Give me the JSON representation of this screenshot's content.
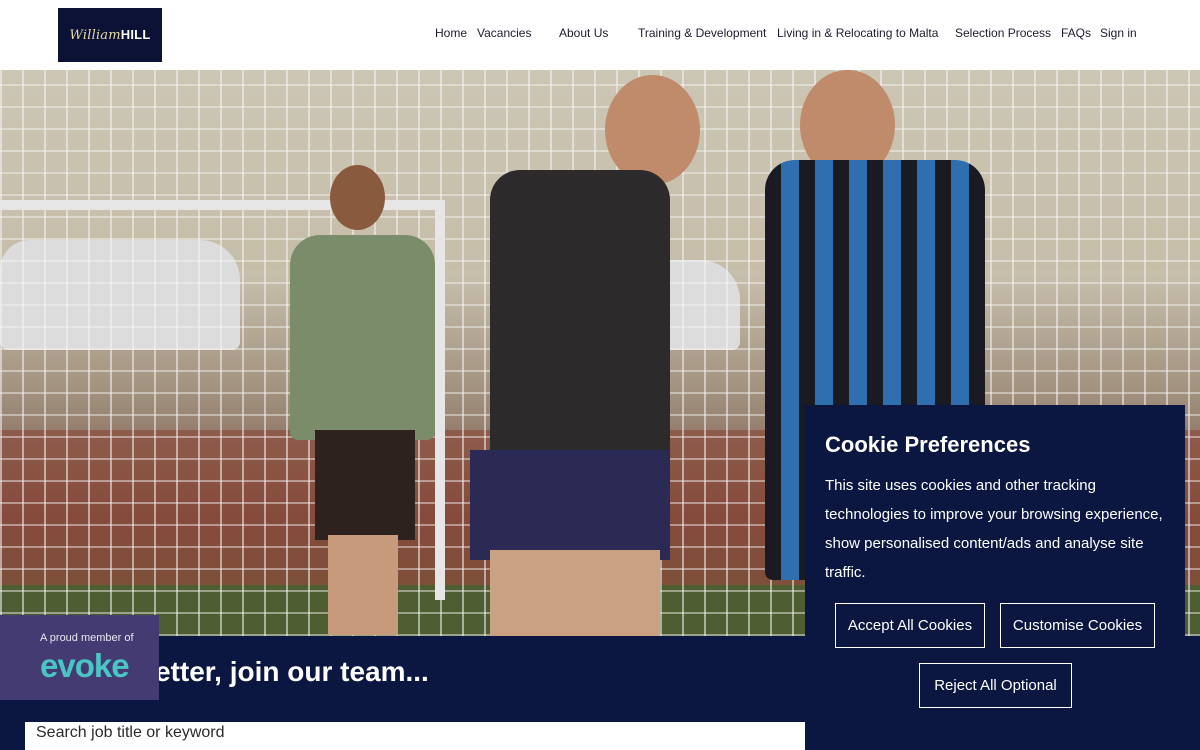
{
  "brand": {
    "logo_script": "William",
    "logo_bold": "HILL"
  },
  "nav": {
    "items": [
      {
        "label": "Home"
      },
      {
        "label": "Vacancies"
      },
      {
        "label": "About Us"
      },
      {
        "label": "Training & Development"
      },
      {
        "label": "Living in & Relocating to Malta"
      },
      {
        "label": "Selection Process"
      },
      {
        "label": "FAQs"
      },
      {
        "label": "Sign in"
      }
    ]
  },
  "hero": {
    "image_description": ""
  },
  "band": {
    "title": "etter, join our team..."
  },
  "search": {
    "placeholder": "Search job title or keyword",
    "button_icon": "search-icon"
  },
  "evoke": {
    "tagline": "A proud member of",
    "logo": "evoke"
  },
  "cookie": {
    "title": "Cookie Preferences",
    "text": "This site uses cookies and other tracking technologies to improve your browsing experience, show personalised content/ads and analyse site traffic.",
    "accept_label": "Accept All Cookies",
    "customise_label": "Customise Cookies",
    "reject_label": "Reject All Optional"
  },
  "colors": {
    "navy": "#0b1740",
    "logo_bg": "#0b1236",
    "evoke_bg": "#453b73",
    "evoke_accent": "#49c6c4"
  }
}
